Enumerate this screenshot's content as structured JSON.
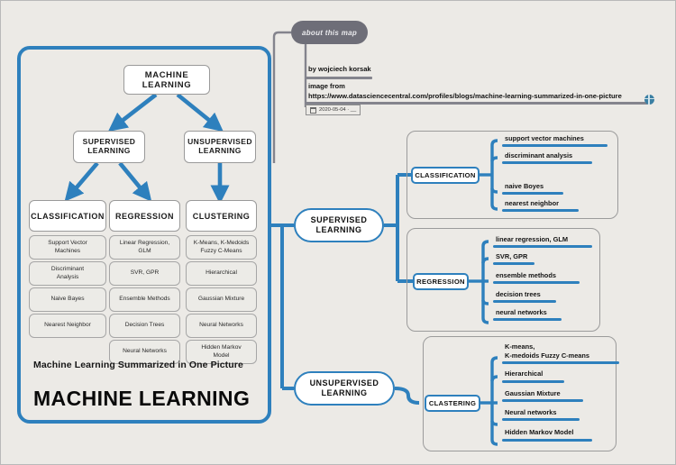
{
  "header": {
    "about_label": "about this map",
    "author": "by wojciech korsak",
    "image_from_label": "image from",
    "source_url": "https://www.datasciencecentral.com/profiles/blogs/machine-learning-summarized-in-one-picture",
    "date": "2020-05-04 · __",
    "globe_icon": "globe-icon",
    "calendar_icon": "calendar-icon"
  },
  "left_panel": {
    "root": "MACHINE LEARNING",
    "level2": [
      {
        "label": "SUPERVISED\nLEARNING",
        "line1": "SUPERVISED",
        "line2": "LEARNING"
      },
      {
        "label": "UNSUPERVISED\nLEARNING",
        "line1": "UNSUPERVISED",
        "line2": "LEARNING"
      }
    ],
    "level3": [
      {
        "label": "CLASSIFICATION"
      },
      {
        "label": "REGRESSION"
      },
      {
        "label": "CLUSTERING"
      }
    ],
    "classification_items": [
      {
        "line1": "Support Vector",
        "line2": "Machines"
      },
      {
        "line1": "Discriminant",
        "line2": "Analysis"
      },
      {
        "line1": "Naive Bayes",
        "line2": ""
      },
      {
        "line1": "Nearest Neighbor",
        "line2": ""
      }
    ],
    "regression_items": [
      {
        "line1": "Linear Regression,",
        "line2": "GLM"
      },
      {
        "line1": "SVR, GPR",
        "line2": ""
      },
      {
        "line1": "Ensemble Methods",
        "line2": ""
      },
      {
        "line1": "Decision Trees",
        "line2": ""
      },
      {
        "line1": "Neural Networks",
        "line2": ""
      }
    ],
    "clustering_items": [
      {
        "line1": "K-Means, K-Medoids",
        "line2": "Fuzzy C-Means"
      },
      {
        "line1": "Hierarchical",
        "line2": ""
      },
      {
        "line1": "Gaussian Mixture",
        "line2": ""
      },
      {
        "line1": "Neural Networks",
        "line2": ""
      },
      {
        "line1": "Hidden Markov",
        "line2": "Model"
      }
    ],
    "subtitle": "Machine Learning Summarized in One Picture",
    "title": "MACHINE LEARNING"
  },
  "right_map": {
    "supervised": {
      "line1": "SUPERVISED",
      "line2": "LEARNING"
    },
    "unsupervised": {
      "line1": "UNSUPERVISED",
      "line2": "LEARNING"
    },
    "classification": {
      "tag": "CLASSIFICATION",
      "items": [
        {
          "line1": "support vector machines",
          "line2": ""
        },
        {
          "line1": "discriminant analysis",
          "line2": ""
        },
        {
          "line1": "naive Boyes",
          "line2": ""
        },
        {
          "line1": "nearest neighbor",
          "line2": ""
        }
      ]
    },
    "regression": {
      "tag": "REGRESSION",
      "items": [
        {
          "line1": "linear regression, GLM",
          "line2": ""
        },
        {
          "line1": "SVR, GPR",
          "line2": ""
        },
        {
          "line1": "ensemble methods",
          "line2": ""
        },
        {
          "line1": "decision trees",
          "line2": ""
        },
        {
          "line1": "neural networks",
          "line2": ""
        }
      ]
    },
    "clustering": {
      "tag": "CLASTERING",
      "items": [
        {
          "line1": "K-means,",
          "line2": "K-medoids Fuzzy C-means"
        },
        {
          "line1": "Hierarchical",
          "line2": ""
        },
        {
          "line1": "Gaussian Mixture",
          "line2": ""
        },
        {
          "line1": "Neural networks",
          "line2": ""
        },
        {
          "line1": "Hidden Markov Model",
          "line2": ""
        }
      ]
    }
  },
  "colors": {
    "accent_blue": "#2e80bd",
    "canvas": "#eceae6",
    "grey_pill": "#6e6e78",
    "leaf_fill": "#ecebe7"
  }
}
